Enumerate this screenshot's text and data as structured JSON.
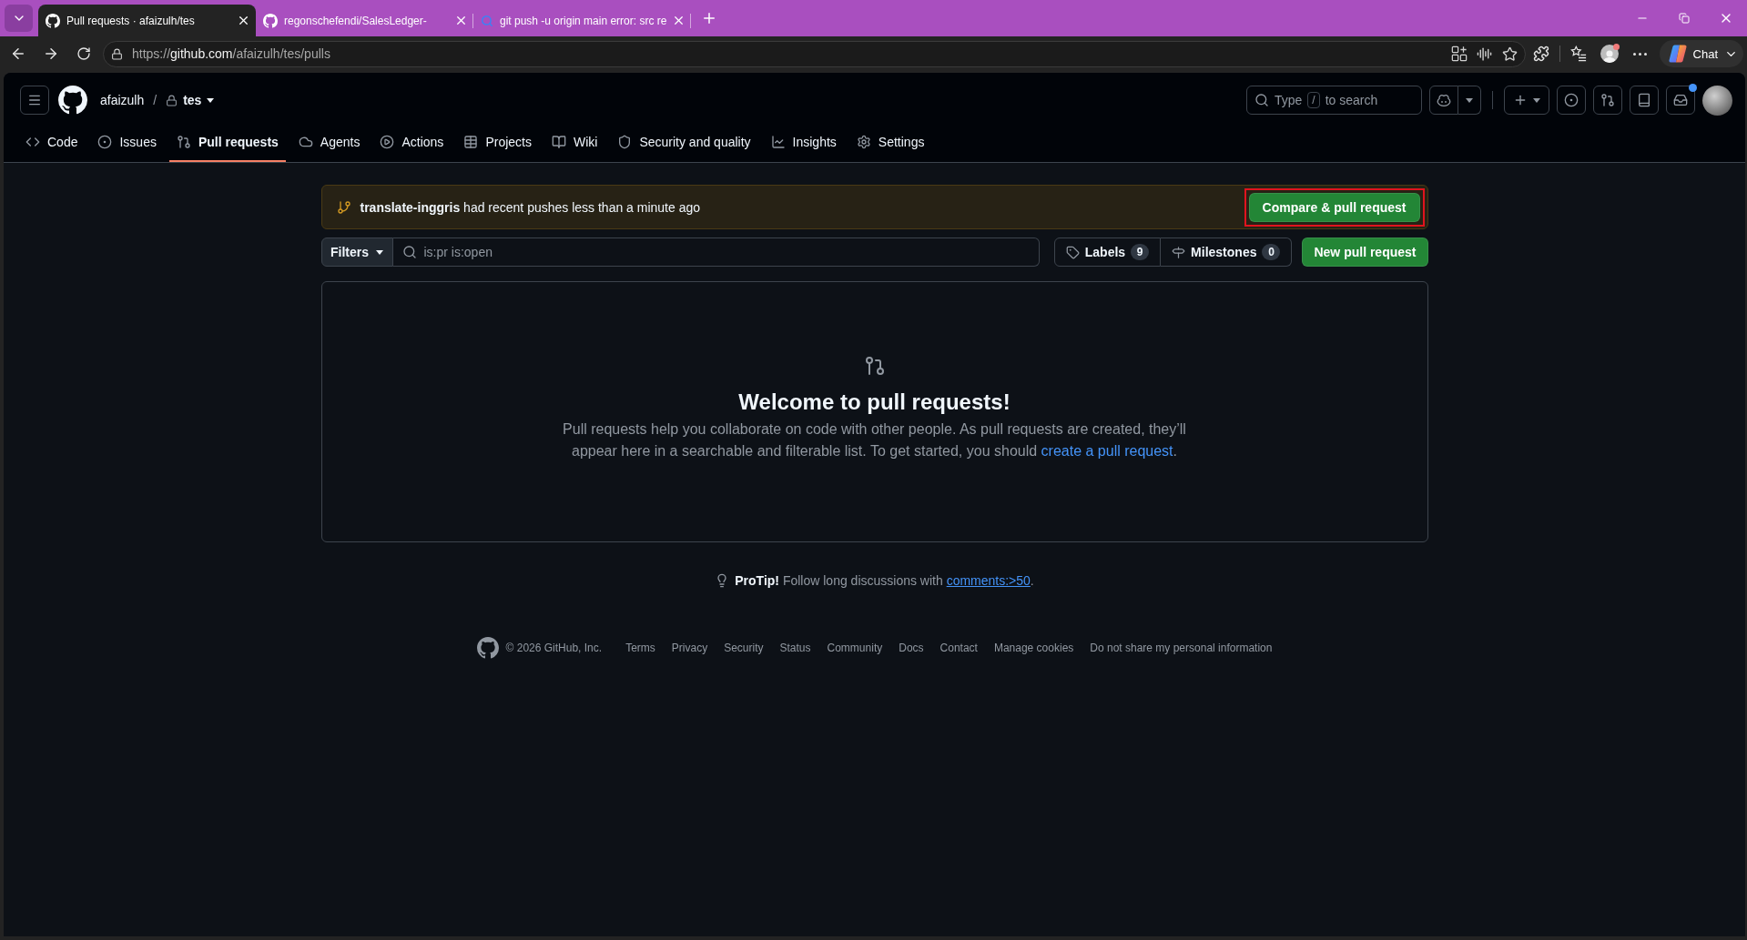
{
  "browser": {
    "tabs": [
      {
        "title": "Pull requests · afaizulh/tes",
        "selected": true
      },
      {
        "title": "regonschefendi/SalesLedger-",
        "selected": false
      },
      {
        "title": "git push -u origin main error: src re",
        "selected": false
      }
    ],
    "url": {
      "scheme": "https://",
      "host": "github.com",
      "path": "/afaizulh/tes/pulls"
    },
    "profile_alert": true,
    "chat_label": "Chat"
  },
  "header": {
    "owner": "afaizulh",
    "separator": "/",
    "repo": "tes",
    "private": true,
    "search": {
      "before": "Type",
      "key": "/",
      "after": "to search"
    },
    "inbox_unread": true
  },
  "nav": [
    {
      "label": "Code",
      "selected": false
    },
    {
      "label": "Issues",
      "selected": false
    },
    {
      "label": "Pull requests",
      "selected": true
    },
    {
      "label": "Agents",
      "selected": false
    },
    {
      "label": "Actions",
      "selected": false
    },
    {
      "label": "Projects",
      "selected": false
    },
    {
      "label": "Wiki",
      "selected": false
    },
    {
      "label": "Security and quality",
      "selected": false
    },
    {
      "label": "Insights",
      "selected": false
    },
    {
      "label": "Settings",
      "selected": false
    }
  ],
  "banner": {
    "text": "**translate-inggris** had recent pushes less than a minute ago",
    "button": "Compare & pull request",
    "button_outlined": true
  },
  "filters": {
    "button": "Filters",
    "query": "is:pr is:open",
    "labels": {
      "label": "Labels",
      "count": "9"
    },
    "milestones": {
      "label": "Milestones",
      "count": "0"
    },
    "new_button": "New pull request"
  },
  "blankslate": {
    "title": "Welcome to pull requests!",
    "text": "Pull requests help you collaborate on code with other people. As pull requests are created, they’ll appear here in a searchable and filterable list. To get started, you should",
    "link": "create a pull request",
    "after": "."
  },
  "protip": {
    "text": "**ProTip!** Follow long discussions with",
    "link": "comments:>50",
    "after": "."
  },
  "footer": {
    "copyright": "© 2026 GitHub, Inc.",
    "links": [
      "Terms",
      "Privacy",
      "Security",
      "Status",
      "Community",
      "Docs",
      "Contact",
      "Manage cookies",
      "Do not share my personal information"
    ]
  }
}
